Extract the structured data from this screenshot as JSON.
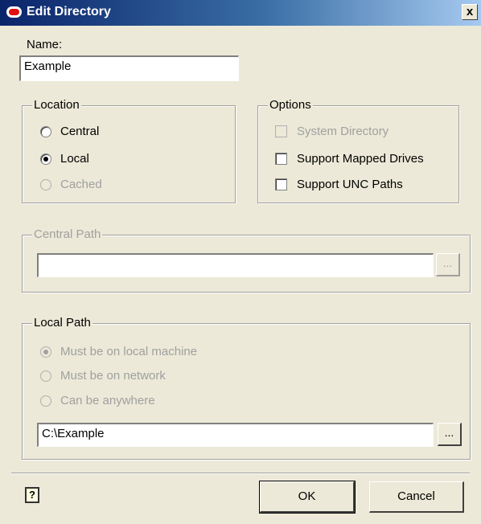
{
  "window": {
    "title": "Edit Directory",
    "close_glyph": "x"
  },
  "name": {
    "label": "Name:",
    "value": "Example"
  },
  "location": {
    "legend": "Location",
    "options": [
      {
        "label": "Central",
        "selected": false,
        "enabled": true
      },
      {
        "label": "Local",
        "selected": true,
        "enabled": true
      },
      {
        "label": "Cached",
        "selected": false,
        "enabled": false
      }
    ]
  },
  "options": {
    "legend": "Options",
    "items": [
      {
        "label": "System Directory",
        "checked": false,
        "enabled": false
      },
      {
        "label": "Support Mapped Drives",
        "checked": false,
        "enabled": true
      },
      {
        "label": "Support UNC Paths",
        "checked": false,
        "enabled": true
      }
    ]
  },
  "central_path": {
    "legend": "Central Path",
    "value": "",
    "browse_label": "...",
    "enabled": false
  },
  "local_path": {
    "legend": "Local Path",
    "options": [
      {
        "label": "Must be on local machine",
        "selected": true,
        "enabled": false
      },
      {
        "label": "Must be on network",
        "selected": false,
        "enabled": false
      },
      {
        "label": "Can be anywhere",
        "selected": false,
        "enabled": false
      }
    ],
    "value": "C:\\Example",
    "browse_label": "..."
  },
  "footer": {
    "help_glyph": "?",
    "ok_label": "OK",
    "cancel_label": "Cancel"
  }
}
